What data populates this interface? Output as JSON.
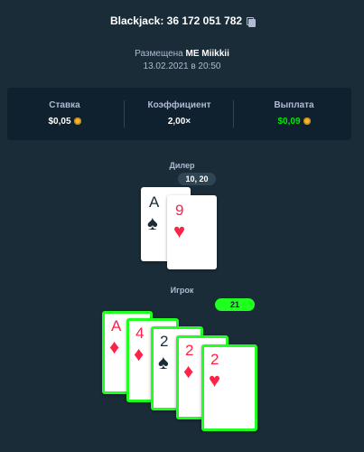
{
  "header": {
    "title": "Blackjack: 36 172 051 782",
    "placed_prefix": "Размещена",
    "placed_by": "ME Miikkii",
    "date": "13.02.2021 в 20:50"
  },
  "stats": {
    "bet_label": "Ставка",
    "bet_value": "$0,05",
    "multiplier_label": "Коэффициент",
    "multiplier_value": "2,00×",
    "payout_label": "Выплата",
    "payout_value": "$0,09"
  },
  "dealer": {
    "label": "Дилер",
    "score": "10, 20",
    "cards": [
      {
        "rank": "A",
        "suit": "♠",
        "color": "black"
      },
      {
        "rank": "9",
        "suit": "♥",
        "color": "red"
      }
    ]
  },
  "player": {
    "label": "Игрок",
    "score": "21",
    "cards": [
      {
        "rank": "A",
        "suit": "♦",
        "color": "red"
      },
      {
        "rank": "4",
        "suit": "♦",
        "color": "red"
      },
      {
        "rank": "2",
        "suit": "♠",
        "color": "black"
      },
      {
        "rank": "2",
        "suit": "♦",
        "color": "red"
      },
      {
        "rank": "2",
        "suit": "♥",
        "color": "red"
      }
    ]
  },
  "colors": {
    "background": "#1a2c38",
    "panel": "#0f212e",
    "win_green": "#1fff20",
    "card_red": "#fe2247"
  },
  "icons": {
    "copy": "copy-icon",
    "coin": "coin-icon"
  }
}
